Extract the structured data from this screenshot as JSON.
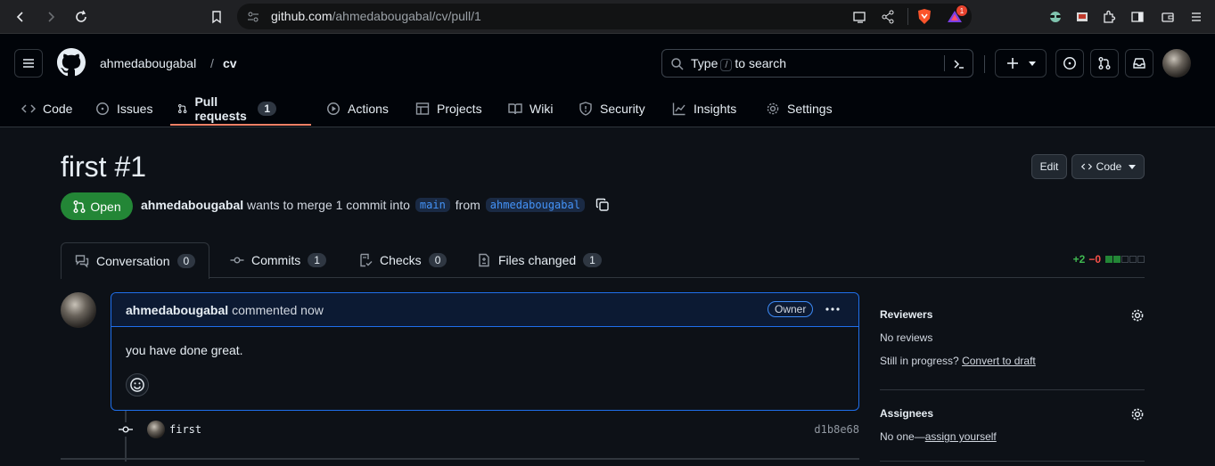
{
  "browser": {
    "url_host": "github.com",
    "url_path": "/ahmedabougabal/cv/pull/1",
    "notification_count": "1"
  },
  "repo": {
    "owner": "ahmedabougabal",
    "separator": "/",
    "name": "cv"
  },
  "search": {
    "prefix": "Type",
    "key": "/",
    "suffix": "to search"
  },
  "nav": {
    "tabs": [
      {
        "label": "Code",
        "icon": "code-icon"
      },
      {
        "label": "Issues",
        "icon": "issue-icon"
      },
      {
        "label": "Pull requests",
        "icon": "pull-request-icon",
        "count": "1",
        "active": true
      },
      {
        "label": "Actions",
        "icon": "play-icon"
      },
      {
        "label": "Projects",
        "icon": "table-icon"
      },
      {
        "label": "Wiki",
        "icon": "book-icon"
      },
      {
        "label": "Security",
        "icon": "shield-icon"
      },
      {
        "label": "Insights",
        "icon": "graph-icon"
      },
      {
        "label": "Settings",
        "icon": "gear-icon"
      }
    ]
  },
  "pr": {
    "title": "first #1",
    "edit_label": "Edit",
    "code_label": "Code",
    "state": "Open",
    "author": "ahmedabougabal",
    "merge_text": "wants to merge 1 commit into",
    "base_branch": "main",
    "from_text": "from",
    "head_branch": "ahmedabougabal"
  },
  "pr_tabs": [
    {
      "label": "Conversation",
      "count": "0"
    },
    {
      "label": "Commits",
      "count": "1"
    },
    {
      "label": "Checks",
      "count": "0"
    },
    {
      "label": "Files changed",
      "count": "1"
    }
  ],
  "diffstat": {
    "additions": "+2",
    "deletions": "−0"
  },
  "comment": {
    "author": "ahmedabougabal",
    "action": "commented now",
    "badge": "Owner",
    "body": "you have done great."
  },
  "commit": {
    "message": "first",
    "sha": "d1b8e68"
  },
  "sidebar": {
    "reviewers_title": "Reviewers",
    "reviewers_value": "No reviews",
    "progress_text": "Still in progress?",
    "convert_link": "Convert to draft",
    "assignees_title": "Assignees",
    "assignees_value": "No one—",
    "assign_link": "assign yourself"
  },
  "colors": {
    "open_green": "#238636",
    "accent_underline": "#f78166",
    "link_blue": "#4493f8"
  }
}
